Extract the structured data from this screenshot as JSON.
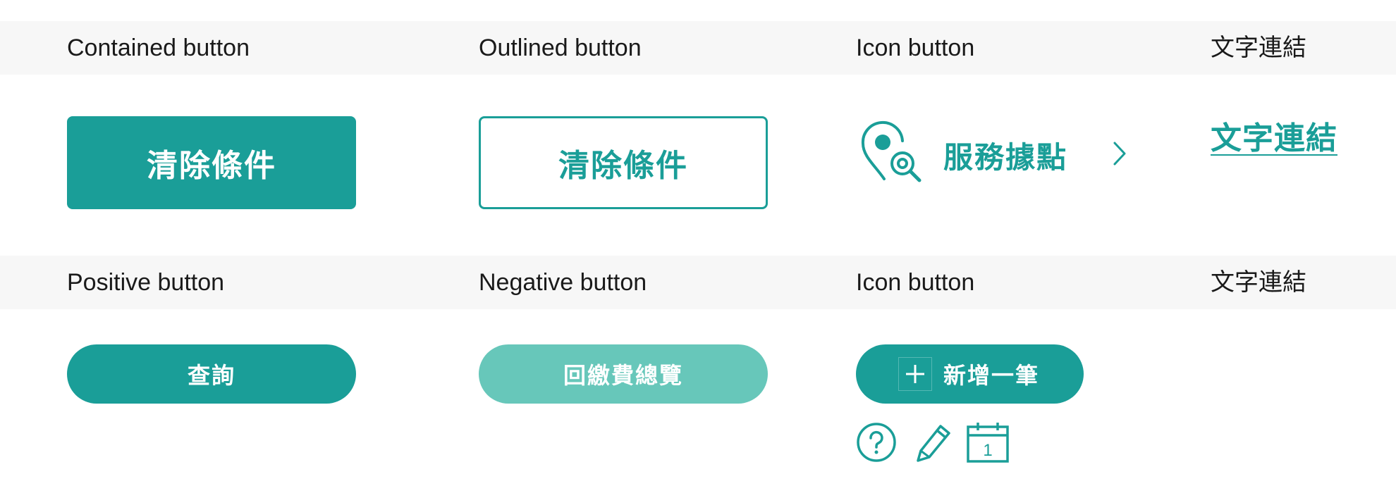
{
  "colors": {
    "primary": "#1a9e98",
    "primary_light": "#67c7ba",
    "band": "#f7f7f7"
  },
  "row1": {
    "headers": {
      "contained": "Contained button",
      "outlined": "Outlined button",
      "icon": "Icon button",
      "textlink": "文字連結"
    },
    "contained_button": {
      "label": "清除條件"
    },
    "outlined_button": {
      "label": "清除條件"
    },
    "icon_button": {
      "label": "服務據點",
      "icon": "location-search-icon",
      "trailing_icon": "chevron-right-icon"
    },
    "text_link": {
      "label": "文字連結"
    }
  },
  "row2": {
    "headers": {
      "positive": "Positive button",
      "negative": "Negative button",
      "icon": "Icon button",
      "textlink": "文字連結"
    },
    "positive_button": {
      "label": "查詢"
    },
    "negative_button": {
      "label": "回繳費總覽"
    },
    "add_button": {
      "label": "新增一筆",
      "icon": "plus-icon"
    },
    "small_icons": [
      {
        "icon": "help-circle-icon"
      },
      {
        "icon": "pencil-icon"
      },
      {
        "icon": "calendar-icon",
        "day": "1"
      }
    ]
  }
}
